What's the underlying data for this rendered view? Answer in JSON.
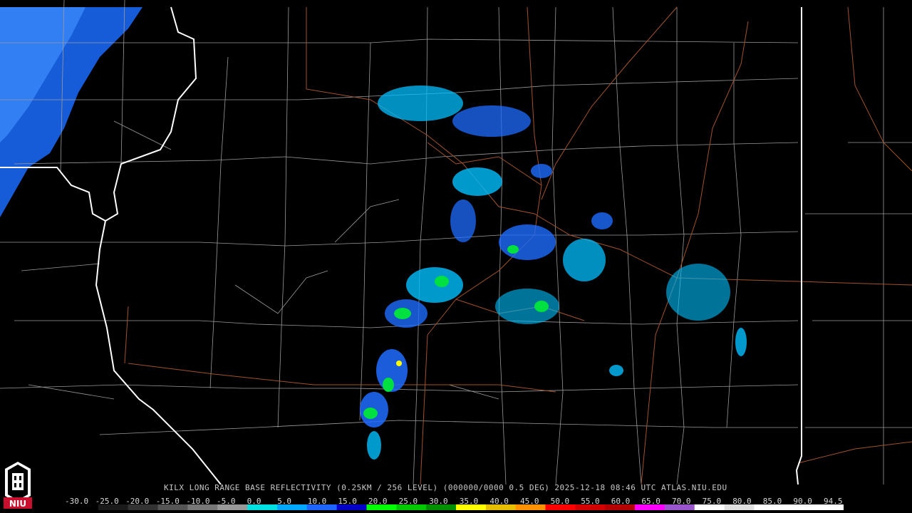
{
  "product_caption": "KILX LONG RANGE BASE REFLECTIVITY (0.25KM / 256 LEVEL) (000000/0000 0.5 DEG) 2025-12-18 08:46 UTC  ATLAS.NIU.EDU",
  "logo_text": "NIU",
  "scale": {
    "ticks": [
      "-30.0",
      "-25.0",
      "-20.0",
      "-15.0",
      "-10.0",
      "-5.0",
      "0.0",
      "5.0",
      "10.0",
      "15.0",
      "20.0",
      "25.0",
      "30.0",
      "35.0",
      "40.0",
      "45.0",
      "50.0",
      "55.0",
      "60.0",
      "65.0",
      "70.0",
      "75.0",
      "80.0",
      "85.0",
      "90.0",
      "94.5"
    ],
    "colors": [
      "#000000",
      "#1a1a1a",
      "#333333",
      "#555555",
      "#777777",
      "#999999",
      "#00e0e0",
      "#00a8ff",
      "#1e64ff",
      "#0000c8",
      "#00ff00",
      "#00c800",
      "#009000",
      "#ffff00",
      "#e6c000",
      "#ff9000",
      "#ff0000",
      "#d20000",
      "#b40000",
      "#ff00ff",
      "#9955cc",
      "#ffffff",
      "#e0e0e0",
      "#ffffff",
      "#ffffff",
      "#ffffff"
    ]
  },
  "colors": {
    "state_border": "#ffffff",
    "county_border": "#a0a0a0",
    "road": "#a0522d",
    "echo_light": "#00bfff",
    "echo_medium": "#1e6cff",
    "echo_strong": "#00e040"
  }
}
